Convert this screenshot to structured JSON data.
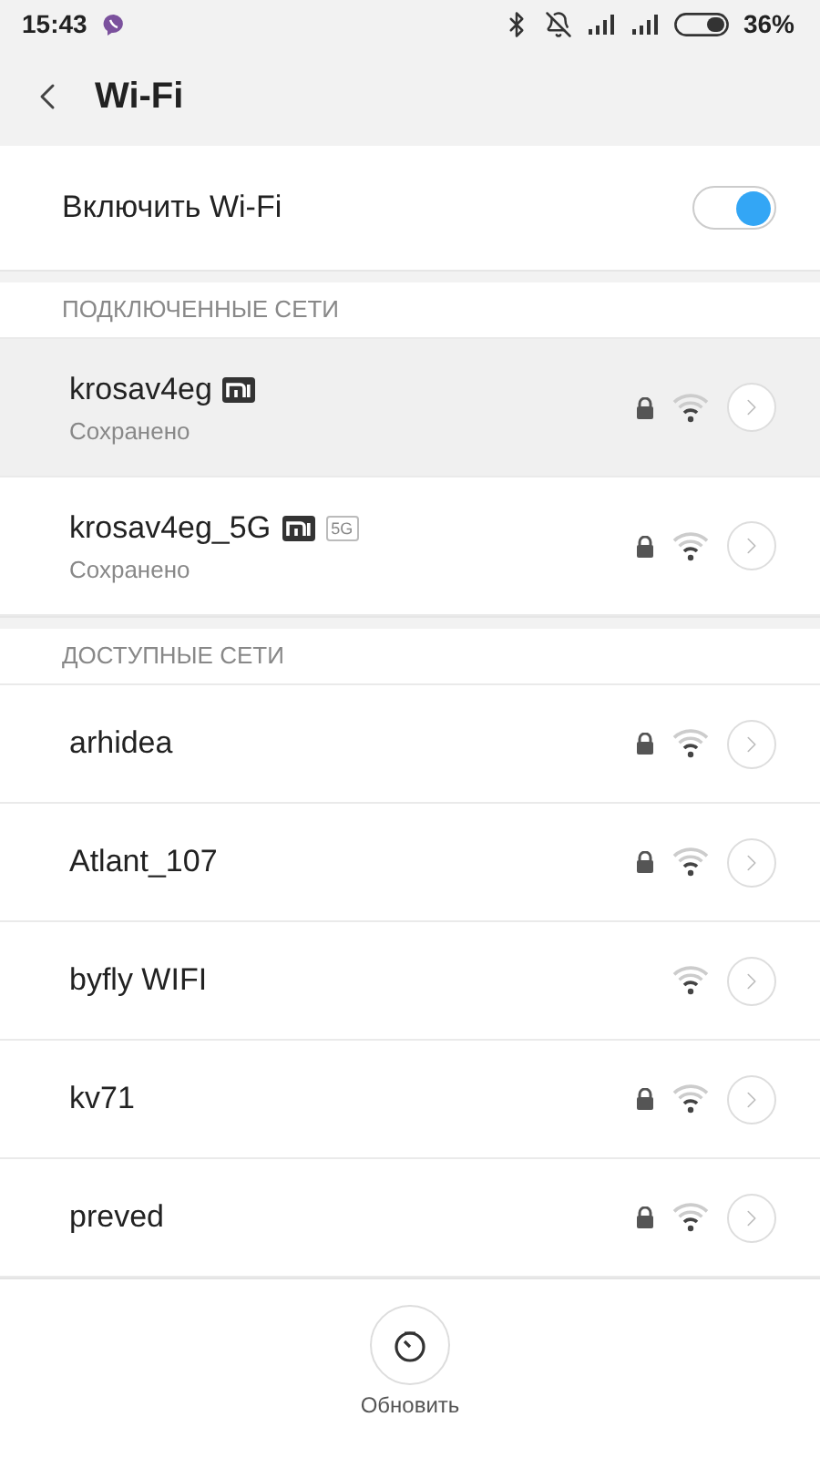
{
  "status_bar": {
    "time": "15:43",
    "battery": "36%"
  },
  "header": {
    "title": "Wi-Fi"
  },
  "wifi_toggle": {
    "label": "Включить Wi-Fi",
    "on": true
  },
  "sections": [
    {
      "title": "ПОДКЛЮЧЕННЫЕ СЕТИ",
      "networks": [
        {
          "name": "krosav4eg",
          "status": "Сохранено",
          "selected": true,
          "secured": true,
          "badges": [
            {
              "kind": "mi"
            }
          ]
        },
        {
          "name": "krosav4eg_5G",
          "status": "Сохранено",
          "selected": false,
          "secured": true,
          "badges": [
            {
              "kind": "mi"
            },
            {
              "kind": "text",
              "text": "5G"
            }
          ]
        }
      ]
    },
    {
      "title": "ДОСТУПНЫЕ СЕТИ",
      "networks": [
        {
          "name": "arhidea",
          "selected": false,
          "secured": true
        },
        {
          "name": "Atlant_107",
          "selected": false,
          "secured": true
        },
        {
          "name": "byfly WIFI",
          "selected": false,
          "secured": false
        },
        {
          "name": "kv71",
          "selected": false,
          "secured": true
        },
        {
          "name": "preved",
          "selected": false,
          "secured": true
        }
      ]
    }
  ],
  "refresh_button": {
    "label": "Обновить"
  }
}
